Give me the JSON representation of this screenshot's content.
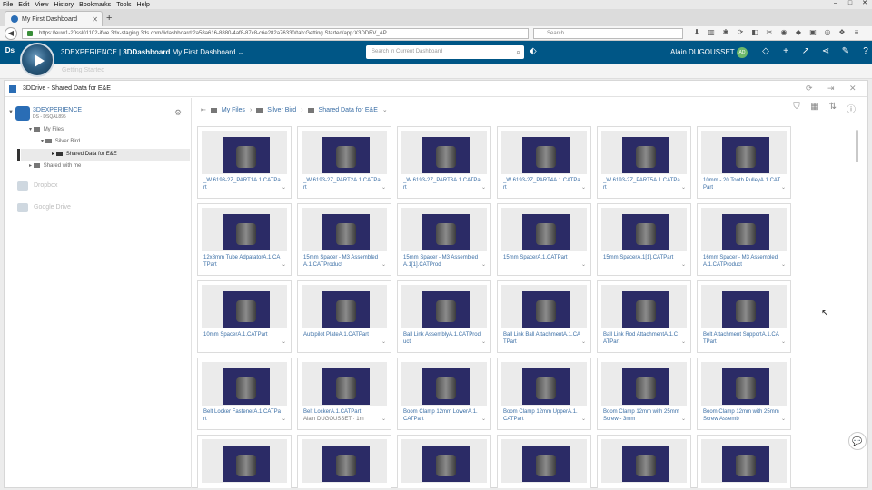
{
  "browser": {
    "menu": [
      "File",
      "Edit",
      "View",
      "History",
      "Bookmarks",
      "Tools",
      "Help"
    ],
    "tab_title": "My First Dashboard",
    "url": "https://euw1-20ssl01102-ifwe.3dx-staging.3ds.com/#dashboard:2a58a616-8880-4af8-87c8-c6e282a76330/tab:Getting Started/app:X3DDRV_AP",
    "search_placeholder": "Search"
  },
  "topbar": {
    "brand": "3DEXPERIENCE",
    "app": "3DDashboard",
    "dashboard": "My First Dashboard",
    "search_placeholder": "Search in Current Dashboard",
    "user": "Alain DUGOUSSET",
    "user_initials": "AD",
    "dash_tab": "Getting Started"
  },
  "widget": {
    "title": "3DDrive - Shared Data for E&E",
    "source": {
      "name": "3DEXPERIENCE",
      "sub": "DS - DSQAL895"
    },
    "tree": {
      "my_files": "My Files",
      "silver_bird": "Silver Bird",
      "shared_folder": "Shared Data for E&E",
      "shared_with_me": "Shared with me"
    },
    "other_sources": [
      "Dropbox",
      "Google Drive"
    ],
    "breadcrumb": [
      "My Files",
      "Silver Bird",
      "Shared Data for E&E"
    ]
  },
  "files": [
    "_W 6193-2Z_PART1A.1.CATPart",
    "_W 6193-2Z_PART2A.1.CATPart",
    "_W 6193-2Z_PART3A.1.CATPart",
    "_W 6193-2Z_PART4A.1.CATPart",
    "_W 6193-2Z_PART5A.1.CATPart",
    "10mm - 20 Tooth PulleyA.1.CATPart",
    "12x8mm Tube AdpatatorA.1.CATPart",
    "15mm Spacer - M3 AssembledA.1.CATProduct",
    "15mm Spacer - M3 AssembledA.1[1].CATProd",
    "15mm SpacerA.1.CATPart",
    "15mm SpacerA.1[1].CATPart",
    "16mm Spacer - M3 AssembledA.1.CATProduct",
    "10mm SpacerA.1.CATPart",
    "Autopilot PlateA.1.CATPart",
    "Ball Link AssemblyA.1.CATProduct",
    "Ball Link Ball AttachmentA.1.CATPart",
    "Ball Link Rod AttachmentA.1.CATPart",
    "Belt Attachment SupportA.1.CATPart",
    "Belt Locker FastenerA.1.CATPart",
    "Belt LockerA.1.CATPart",
    "Boom Clamp 12mm LowerA.1.CATPart",
    "Boom Clamp 12mm UpperA.1.CATPart",
    "Boom Clamp 12mm with 25mm Screw - 3mm",
    "Boom Clamp 12mm with 25mm Screw Assemb",
    "",
    "",
    "",
    "",
    "",
    ""
  ],
  "belt_locker_owner": "Alain DUGOUSSET · 1m"
}
